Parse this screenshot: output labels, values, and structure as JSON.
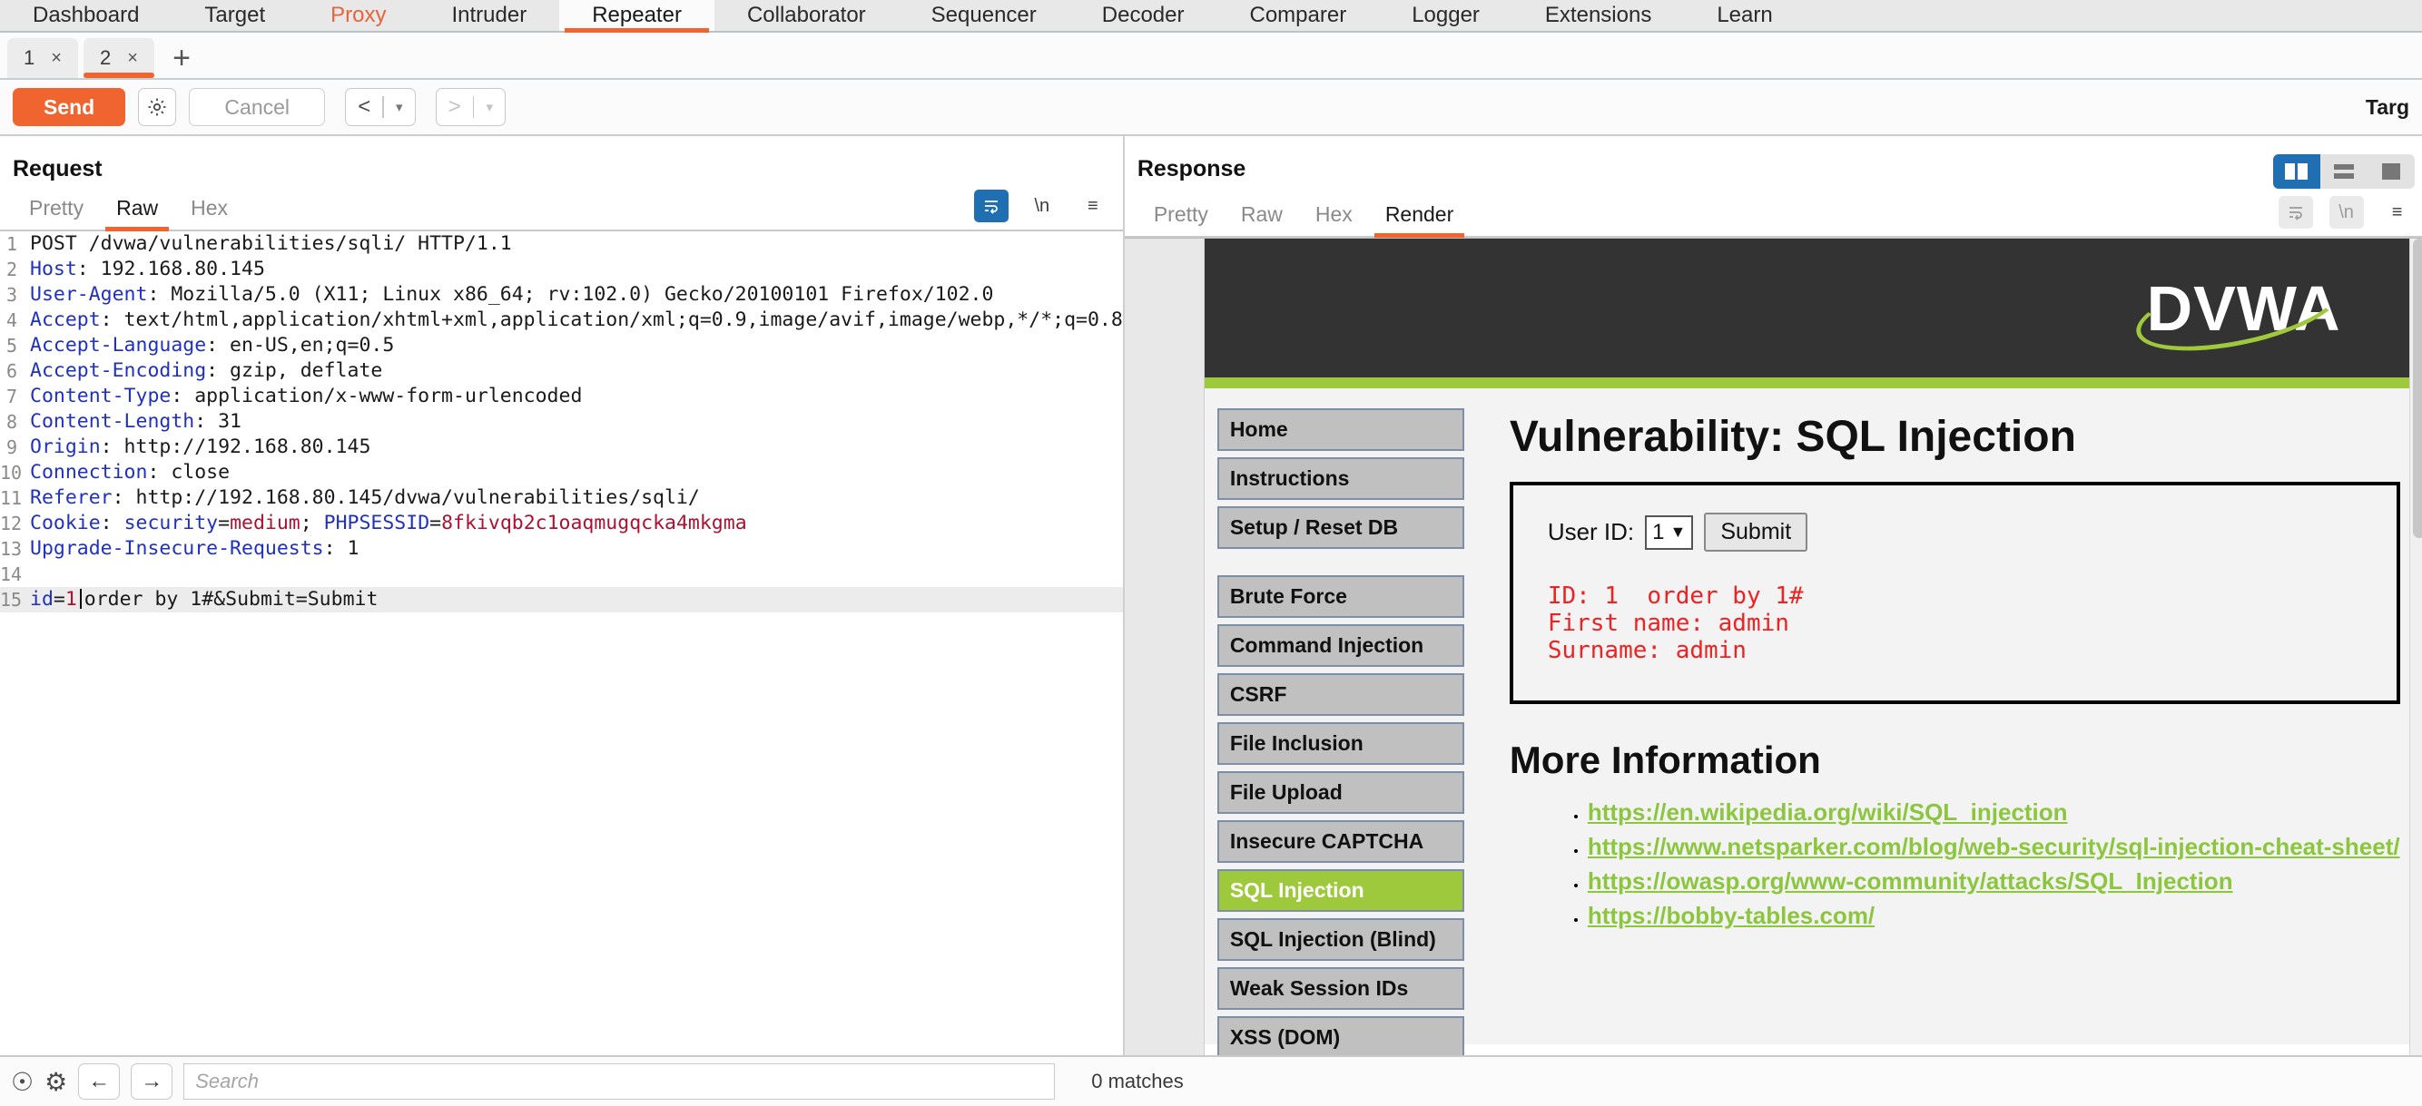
{
  "suite_tabs": [
    {
      "label": "Dashboard",
      "state": "normal"
    },
    {
      "label": "Target",
      "state": "normal"
    },
    {
      "label": "Proxy",
      "state": "proxy"
    },
    {
      "label": "Intruder",
      "state": "normal"
    },
    {
      "label": "Repeater",
      "state": "active"
    },
    {
      "label": "Collaborator",
      "state": "normal"
    },
    {
      "label": "Sequencer",
      "state": "normal"
    },
    {
      "label": "Decoder",
      "state": "normal"
    },
    {
      "label": "Comparer",
      "state": "normal"
    },
    {
      "label": "Logger",
      "state": "normal"
    },
    {
      "label": "Extensions",
      "state": "normal"
    },
    {
      "label": "Learn",
      "state": "normal"
    }
  ],
  "repeater_tabs": [
    {
      "label": "1",
      "close": "×",
      "active": false
    },
    {
      "label": "2",
      "close": "×",
      "active": true
    }
  ],
  "repeater_add_label": "+",
  "action_bar": {
    "send_label": "Send",
    "settings_icon": "gear-icon",
    "cancel_label": "Cancel",
    "prev_icon": "<",
    "next_icon": ">",
    "dropdown_icon": "▾",
    "target_label": "Targ"
  },
  "request": {
    "title": "Request",
    "tabs": [
      {
        "label": "Pretty",
        "active": false
      },
      {
        "label": "Raw",
        "active": true
      },
      {
        "label": "Hex",
        "active": false
      }
    ],
    "icons": [
      {
        "name": "word-wrap-icon",
        "glyph": "↵",
        "state": "selected"
      },
      {
        "name": "newline-icon",
        "glyph": "\\n",
        "state": "normal"
      },
      {
        "name": "menu-icon",
        "glyph": "≡",
        "state": "normal"
      }
    ],
    "lines": [
      {
        "n": "1",
        "segments": [
          {
            "t": "POST /dvwa/vulnerabilities/sqli/ HTTP/1.1",
            "c": "plain"
          }
        ]
      },
      {
        "n": "2",
        "segments": [
          {
            "t": "Host",
            "c": "hdr"
          },
          {
            "t": ": 192.168.80.145",
            "c": "plain"
          }
        ]
      },
      {
        "n": "3",
        "segments": [
          {
            "t": "User-Agent",
            "c": "hdr"
          },
          {
            "t": ": Mozilla/5.0 (X11; Linux x86_64; rv:102.0) Gecko/20100101 Firefox/102.0",
            "c": "plain"
          }
        ]
      },
      {
        "n": "4",
        "segments": [
          {
            "t": "Accept",
            "c": "hdr"
          },
          {
            "t": ": text/html,application/xhtml+xml,application/xml;q=0.9,image/avif,image/webp,*/*;q=0.8",
            "c": "plain"
          }
        ]
      },
      {
        "n": "5",
        "segments": [
          {
            "t": "Accept-Language",
            "c": "hdr"
          },
          {
            "t": ": en-US,en;q=0.5",
            "c": "plain"
          }
        ]
      },
      {
        "n": "6",
        "segments": [
          {
            "t": "Accept-Encoding",
            "c": "hdr"
          },
          {
            "t": ": gzip, deflate",
            "c": "plain"
          }
        ]
      },
      {
        "n": "7",
        "segments": [
          {
            "t": "Content-Type",
            "c": "hdr"
          },
          {
            "t": ": application/x-www-form-urlencoded",
            "c": "plain"
          }
        ]
      },
      {
        "n": "8",
        "segments": [
          {
            "t": "Content-Length",
            "c": "hdr"
          },
          {
            "t": ": 31",
            "c": "plain"
          }
        ]
      },
      {
        "n": "9",
        "segments": [
          {
            "t": "Origin",
            "c": "hdr"
          },
          {
            "t": ": http://192.168.80.145",
            "c": "plain"
          }
        ]
      },
      {
        "n": "10",
        "segments": [
          {
            "t": "Connection",
            "c": "hdr"
          },
          {
            "t": ": close",
            "c": "plain"
          }
        ]
      },
      {
        "n": "11",
        "segments": [
          {
            "t": "Referer",
            "c": "hdr"
          },
          {
            "t": ": http://192.168.80.145/dvwa/vulnerabilities/sqli/",
            "c": "plain"
          }
        ]
      },
      {
        "n": "12",
        "segments": [
          {
            "t": "Cookie",
            "c": "hdr"
          },
          {
            "t": ": ",
            "c": "plain"
          },
          {
            "t": "security",
            "c": "hdr"
          },
          {
            "t": "=",
            "c": "plain"
          },
          {
            "t": "medium",
            "c": "red"
          },
          {
            "t": "; ",
            "c": "plain"
          },
          {
            "t": "PHPSESSID",
            "c": "hdr"
          },
          {
            "t": "=",
            "c": "plain"
          },
          {
            "t": "8fkivqb2c1oaqmugqcka4mkgma",
            "c": "red"
          }
        ]
      },
      {
        "n": "13",
        "segments": [
          {
            "t": "Upgrade-Insecure-Requests",
            "c": "hdr"
          },
          {
            "t": ": 1",
            "c": "plain"
          }
        ]
      },
      {
        "n": "14",
        "segments": []
      },
      {
        "n": "15",
        "highlight": true,
        "segments": [
          {
            "t": "id",
            "c": "hdr"
          },
          {
            "t": "=",
            "c": "plain"
          },
          {
            "t": "1",
            "c": "red"
          },
          {
            "t": "CARET",
            "c": "caret"
          },
          {
            "t": "order by 1#&Submit=Submit",
            "c": "plain"
          }
        ]
      }
    ]
  },
  "response": {
    "title": "Response",
    "tabs": [
      {
        "label": "Pretty",
        "active": false
      },
      {
        "label": "Raw",
        "active": false
      },
      {
        "label": "Hex",
        "active": false
      },
      {
        "label": "Render",
        "active": true
      }
    ],
    "layout_icons": [
      {
        "name": "split-vertical-icon",
        "state": "selected"
      },
      {
        "name": "split-horizontal-icon",
        "state": "normal"
      },
      {
        "name": "single-pane-icon",
        "state": "normal"
      }
    ],
    "icons": [
      {
        "name": "word-wrap-icon",
        "glyph": "↵",
        "state": "dim"
      },
      {
        "name": "newline-icon",
        "glyph": "\\n",
        "state": "dim"
      },
      {
        "name": "menu-icon",
        "glyph": "≡",
        "state": "normal"
      }
    ]
  },
  "dvwa": {
    "logo": "DVWA",
    "nav_group_1": [
      "Home",
      "Instructions",
      "Setup / Reset DB"
    ],
    "nav_group_2": [
      {
        "label": "Brute Force",
        "active": false
      },
      {
        "label": "Command Injection",
        "active": false
      },
      {
        "label": "CSRF",
        "active": false
      },
      {
        "label": "File Inclusion",
        "active": false
      },
      {
        "label": "File Upload",
        "active": false
      },
      {
        "label": "Insecure CAPTCHA",
        "active": false
      },
      {
        "label": "SQL Injection",
        "active": true
      },
      {
        "label": "SQL Injection (Blind)",
        "active": false
      },
      {
        "label": "Weak Session IDs",
        "active": false
      },
      {
        "label": "XSS (DOM)",
        "active": false
      }
    ],
    "vuln_title": "Vulnerability: SQL Injection",
    "form": {
      "user_id_label": "User ID:",
      "select_value": "1",
      "select_caret": "⌄",
      "submit_label": "Submit"
    },
    "result_lines": [
      "ID: 1  order by 1#",
      "First name: admin",
      "Surname: admin"
    ],
    "more_info_title": "More Information",
    "more_info_links": [
      "https://en.wikipedia.org/wiki/SQL_injection",
      "https://www.netsparker.com/blog/web-security/sql-injection-cheat-sheet/",
      "https://owasp.org/www-community/attacks/SQL_Injection",
      "https://bobby-tables.com/"
    ]
  },
  "bottom_bar": {
    "help_icon": "question-circle-icon",
    "settings_icon": "gear-icon",
    "back_icon": "←",
    "forward_icon": "→",
    "search_placeholder": "Search",
    "search_value": "",
    "matches_label": "0 matches"
  },
  "colors": {
    "accent": "#f0652f",
    "header_blue": "#2030c0",
    "value_red": "#b01030",
    "dvwa_green": "#9fc93c",
    "select_blue": "#1f6fb2"
  }
}
